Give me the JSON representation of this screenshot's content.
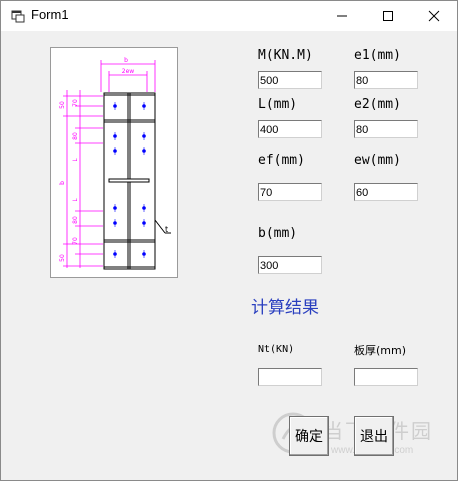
{
  "window": {
    "title": "Form1"
  },
  "inputs": {
    "M": {
      "label": "M(KN.M)",
      "value": "500"
    },
    "e1": {
      "label": "e1(mm)",
      "value": "80"
    },
    "L": {
      "label": "L(mm)",
      "value": "400"
    },
    "e2": {
      "label": "e2(mm)",
      "value": "80"
    },
    "ef": {
      "label": "ef(mm)",
      "value": "70"
    },
    "ew": {
      "label": "ew(mm)",
      "value": "60"
    },
    "b": {
      "label": "b(mm)",
      "value": "300"
    }
  },
  "results": {
    "heading": "计算结果",
    "Nt": {
      "label": "Nt(KN)",
      "value": ""
    },
    "thickness": {
      "label": "板厚(mm)",
      "value": ""
    }
  },
  "buttons": {
    "confirm": "确定",
    "exit": "退出"
  },
  "diagram": {
    "top_labels": [
      "b",
      "2ew"
    ],
    "side_labels": [
      "50",
      "70",
      "80",
      "L",
      "L",
      "80",
      "70",
      "50"
    ],
    "outer_label": "b",
    "plate_label": "t",
    "accent_color": "#ff00ff",
    "bolt_color": "#0000ff"
  },
  "watermark": {
    "text": "当下软件园",
    "url": "www.downxia.com"
  }
}
